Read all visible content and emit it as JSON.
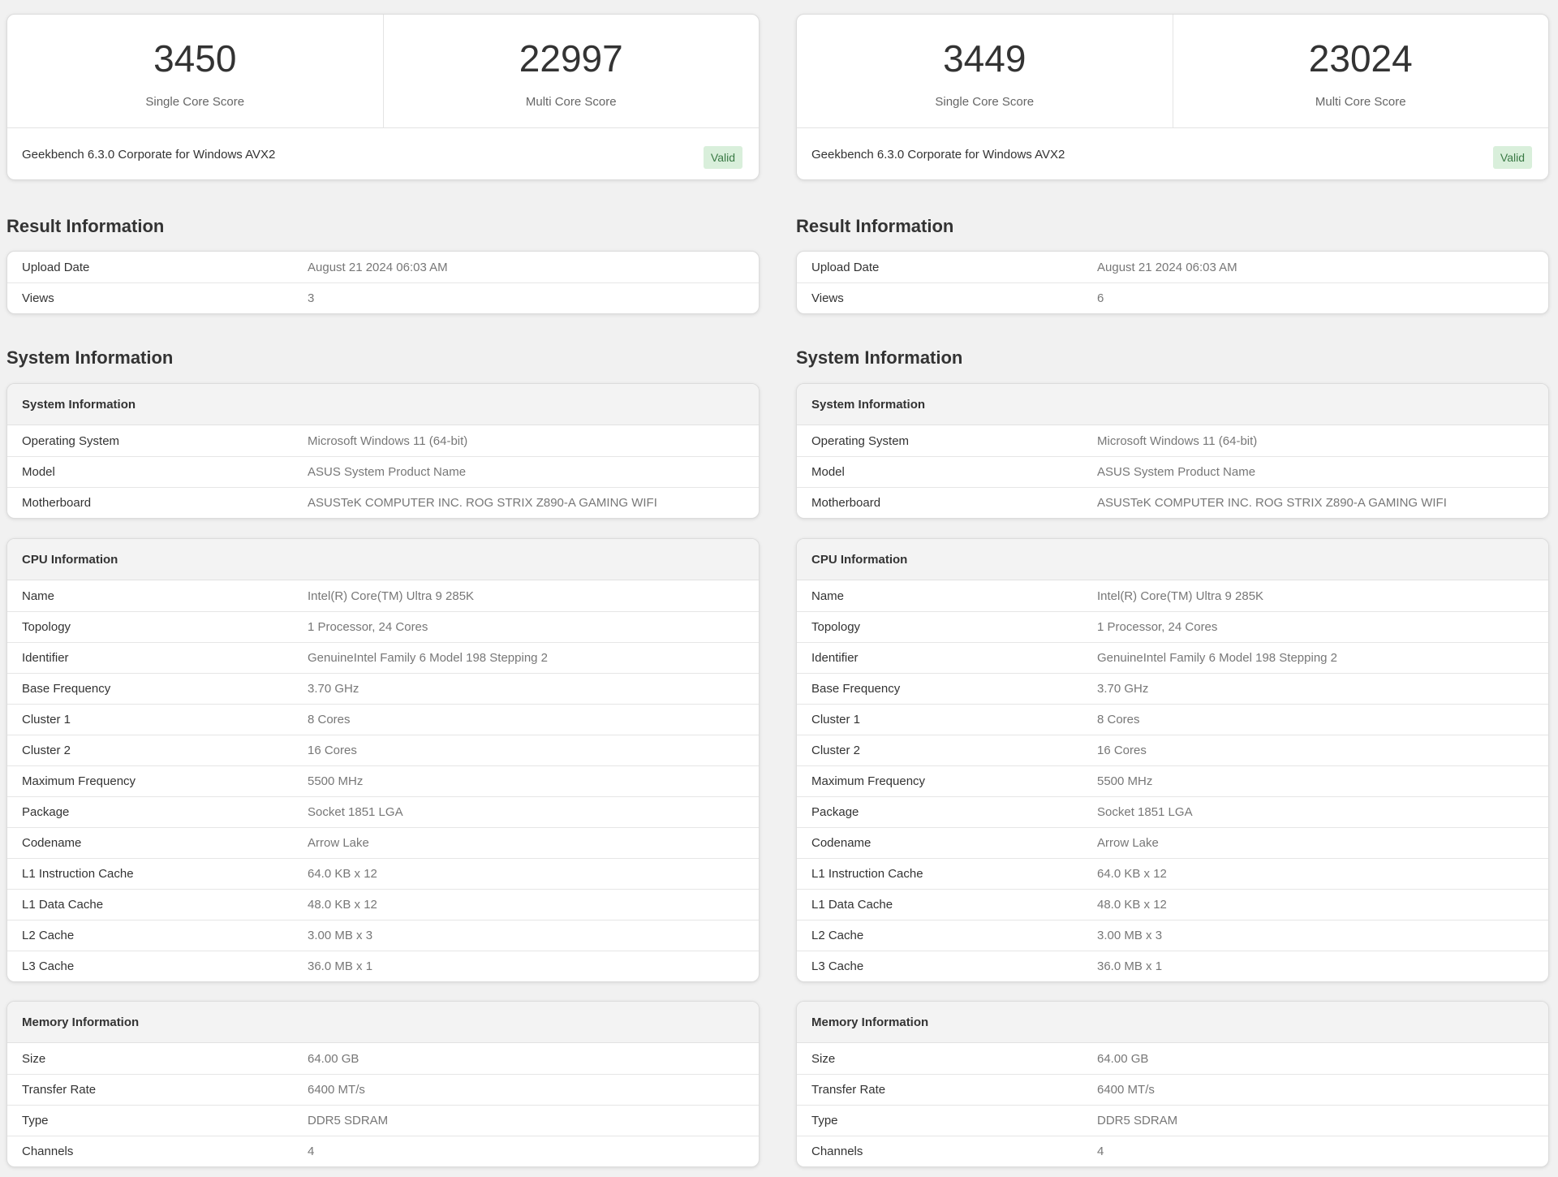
{
  "left": {
    "single_score": "3450",
    "single_label": "Single Core Score",
    "multi_score": "22997",
    "multi_label": "Multi Core Score",
    "version": "Geekbench 6.3.0 Corporate for Windows AVX2",
    "badge": "Valid",
    "result_title": "Result Information",
    "result_rows": [
      {
        "key": "Upload Date",
        "value": "August 21 2024 06:03 AM"
      },
      {
        "key": "Views",
        "value": "3"
      }
    ],
    "system_title": "System Information",
    "system_card_title": "System Information",
    "system_rows": [
      {
        "key": "Operating System",
        "value": "Microsoft Windows 11 (64-bit)"
      },
      {
        "key": "Model",
        "value": "ASUS System Product Name"
      },
      {
        "key": "Motherboard",
        "value": "ASUSTeK COMPUTER INC. ROG STRIX Z890-A GAMING WIFI"
      }
    ],
    "cpu_title": "CPU Information",
    "cpu_rows": [
      {
        "key": "Name",
        "value": "Intel(R) Core(TM) Ultra 9 285K"
      },
      {
        "key": "Topology",
        "value": "1 Processor, 24 Cores"
      },
      {
        "key": "Identifier",
        "value": "GenuineIntel Family 6 Model 198 Stepping 2"
      },
      {
        "key": "Base Frequency",
        "value": "3.70 GHz"
      },
      {
        "key": "Cluster 1",
        "value": "8 Cores"
      },
      {
        "key": "Cluster 2",
        "value": "16 Cores"
      },
      {
        "key": "Maximum Frequency",
        "value": "5500 MHz"
      },
      {
        "key": "Package",
        "value": "Socket 1851 LGA"
      },
      {
        "key": "Codename",
        "value": "Arrow Lake"
      },
      {
        "key": "L1 Instruction Cache",
        "value": "64.0 KB x 12"
      },
      {
        "key": "L1 Data Cache",
        "value": "48.0 KB x 12"
      },
      {
        "key": "L2 Cache",
        "value": "3.00 MB x 3"
      },
      {
        "key": "L3 Cache",
        "value": "36.0 MB x 1"
      }
    ],
    "memory_title": "Memory Information",
    "memory_rows": [
      {
        "key": "Size",
        "value": "64.00 GB"
      },
      {
        "key": "Transfer Rate",
        "value": "6400 MT/s"
      },
      {
        "key": "Type",
        "value": "DDR5 SDRAM"
      },
      {
        "key": "Channels",
        "value": "4"
      }
    ]
  },
  "right": {
    "single_score": "3449",
    "single_label": "Single Core Score",
    "multi_score": "23024",
    "multi_label": "Multi Core Score",
    "version": "Geekbench 6.3.0 Corporate for Windows AVX2",
    "badge": "Valid",
    "result_title": "Result Information",
    "result_rows": [
      {
        "key": "Upload Date",
        "value": "August 21 2024 06:03 AM"
      },
      {
        "key": "Views",
        "value": "6"
      }
    ],
    "system_title": "System Information",
    "system_card_title": "System Information",
    "system_rows": [
      {
        "key": "Operating System",
        "value": "Microsoft Windows 11 (64-bit)"
      },
      {
        "key": "Model",
        "value": "ASUS System Product Name"
      },
      {
        "key": "Motherboard",
        "value": "ASUSTeK COMPUTER INC. ROG STRIX Z890-A GAMING WIFI"
      }
    ],
    "cpu_title": "CPU Information",
    "cpu_rows": [
      {
        "key": "Name",
        "value": "Intel(R) Core(TM) Ultra 9 285K"
      },
      {
        "key": "Topology",
        "value": "1 Processor, 24 Cores"
      },
      {
        "key": "Identifier",
        "value": "GenuineIntel Family 6 Model 198 Stepping 2"
      },
      {
        "key": "Base Frequency",
        "value": "3.70 GHz"
      },
      {
        "key": "Cluster 1",
        "value": "8 Cores"
      },
      {
        "key": "Cluster 2",
        "value": "16 Cores"
      },
      {
        "key": "Maximum Frequency",
        "value": "5500 MHz"
      },
      {
        "key": "Package",
        "value": "Socket 1851 LGA"
      },
      {
        "key": "Codename",
        "value": "Arrow Lake"
      },
      {
        "key": "L1 Instruction Cache",
        "value": "64.0 KB x 12"
      },
      {
        "key": "L1 Data Cache",
        "value": "48.0 KB x 12"
      },
      {
        "key": "L2 Cache",
        "value": "3.00 MB x 3"
      },
      {
        "key": "L3 Cache",
        "value": "36.0 MB x 1"
      }
    ],
    "memory_title": "Memory Information",
    "memory_rows": [
      {
        "key": "Size",
        "value": "64.00 GB"
      },
      {
        "key": "Transfer Rate",
        "value": "6400 MT/s"
      },
      {
        "key": "Type",
        "value": "DDR5 SDRAM"
      },
      {
        "key": "Channels",
        "value": "4"
      }
    ]
  }
}
